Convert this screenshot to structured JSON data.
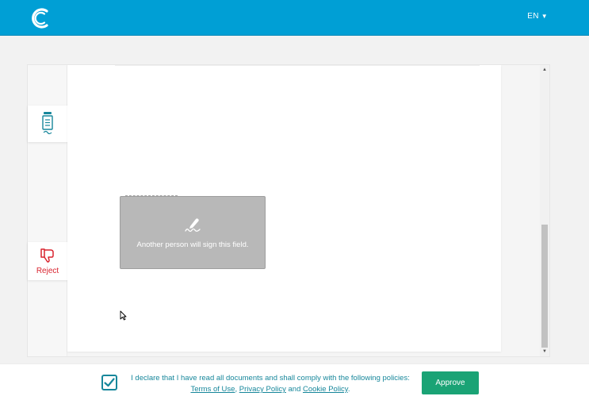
{
  "header": {
    "language": "EN",
    "language_caret": "▼",
    "logo_icon": "c-logo-icon",
    "brand_color": "#009fd5"
  },
  "viewer": {
    "rail": {
      "document_icon": "document-list-icon",
      "reject_icon": "thumbs-down-icon",
      "reject_label": "Reject",
      "reject_color": "#d9232e"
    },
    "signature_field": {
      "icon": "signature-pen-icon",
      "text": "Another person will sign this field."
    },
    "scrollbar": {
      "up_icon": "scroll-up-arrow-icon",
      "down_icon": "scroll-down-arrow-icon"
    }
  },
  "footer": {
    "declaration_text": "I declare that I have read all documents and shall comply with the following policies:",
    "terms_link": "Terms of Use",
    "comma": ",",
    "privacy_link": "Privacy Policy",
    "and_text": " and ",
    "cookie_link": "Cookie Policy",
    "period": ".",
    "checkbox_checked": true,
    "approve_label": "Approve",
    "accent_color": "#17879b",
    "approve_color": "#1aa375"
  }
}
